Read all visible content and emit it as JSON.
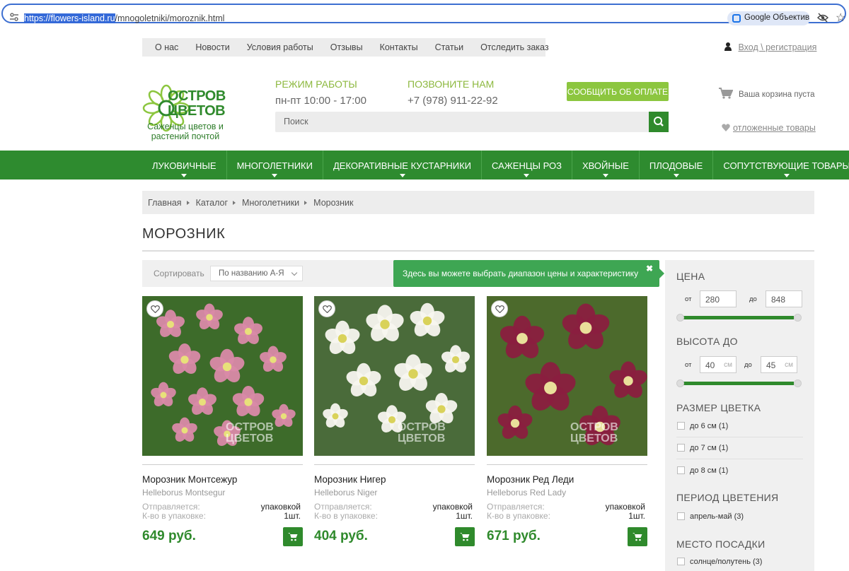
{
  "browser": {
    "url_selected": "https://flowers-island.ru",
    "url_rest": "/mnogoletniki/moroznik.html",
    "lens_label": "Google Объектив"
  },
  "topnav": {
    "items": [
      "О нас",
      "Новости",
      "Условия работы",
      "Отзывы",
      "Контакты",
      "Статьи",
      "Отследить заказ"
    ]
  },
  "login": {
    "label": "Вход \\ регистрация"
  },
  "logo": {
    "name_line1": "ОСТРОВ",
    "name_line2": "ЦВЕТОВ",
    "subtitle_line1": "Саженцы цветов и",
    "subtitle_line2": "растений почтой"
  },
  "hours": {
    "heading": "РЕЖИМ РАБОТЫ",
    "value": "пн-пт 10:00 - 17:00"
  },
  "phone": {
    "heading": "ПОЗВОНИТЕ НАМ",
    "value": "+7 (978) 911-22-92"
  },
  "payment_button": "СООБЩИТЬ ОБ ОПЛАТЕ",
  "cart": {
    "status": "Ваша корзина пуста"
  },
  "search": {
    "placeholder": "Поиск"
  },
  "wishlist": {
    "label": "отложенные товары"
  },
  "mainnav": {
    "items": [
      "ЛУКОВИЧНЫЕ",
      "МНОГОЛЕТНИКИ",
      "ДЕКОРАТИВНЫЕ КУСТАРНИКИ",
      "САЖЕНЦЫ РОЗ",
      "ХВОЙНЫЕ",
      "ПЛОДОВЫЕ",
      "СОПУТСТВУЮЩИЕ ТОВАРЫ"
    ]
  },
  "breadcrumb": [
    "Главная",
    "Каталог",
    "Многолетники",
    "Морозник"
  ],
  "page_title": "МОРОЗНИК",
  "sort": {
    "label": "Сортировать",
    "selected": "По названию А-Я"
  },
  "tooltip": {
    "text": "Здесь вы можете выбрать диапазон цены и характеристику",
    "close": "✖"
  },
  "products": [
    {
      "name": "Морозник Монтсежур",
      "latin": "Helleborus Montsegur",
      "ship_label": "Отправляется:",
      "ship_value": "упаковкой",
      "qty_label": "К-во в упаковке:",
      "qty_value": "1шт.",
      "price": "649 руб.",
      "watermark_line1": "ОСТРОВ",
      "watermark_line2": "ЦВЕТОВ",
      "palette": {
        "bg": "#3d6b2a",
        "petal": "#d98aa8",
        "center": "#e8e07a"
      }
    },
    {
      "name": "Морозник Нигер",
      "latin": "Helleborus Niger",
      "ship_label": "Отправляется:",
      "ship_value": "упаковкой",
      "qty_label": "К-во в упаковке:",
      "qty_value": "1шт.",
      "price": "404 руб.",
      "watermark_line1": "ОСТРОВ",
      "watermark_line2": "ЦВЕТОВ",
      "palette": {
        "bg": "#4a6b3a",
        "petal": "#f7f5ef",
        "center": "#d9d25a"
      }
    },
    {
      "name": "Морозник Ред Леди",
      "latin": "Helleborus Red Lady",
      "ship_label": "Отправляется:",
      "ship_value": "упаковкой",
      "qty_label": "К-во в упаковке:",
      "qty_value": "1шт.",
      "price": "671 руб.",
      "watermark_line1": "ОСТРОВ",
      "watermark_line2": "ЦВЕТОВ",
      "palette": {
        "bg": "#4c6a2c",
        "petal": "#8a1f3f",
        "center": "#e9df9a"
      }
    }
  ],
  "filters": {
    "price": {
      "heading": "ЦЕНА",
      "from_label": "от",
      "from_value": "280",
      "to_label": "до",
      "to_value": "848"
    },
    "height": {
      "heading": "ВЫСОТА ДО",
      "from_label": "от",
      "from_value": "40",
      "to_label": "до",
      "to_value": "45",
      "unit": "см"
    },
    "flower_size": {
      "heading": "РАЗМЕР ЦВЕТКА",
      "options": [
        "до 6 см (1)",
        "до 7 см (1)",
        "до 8 см (1)"
      ]
    },
    "bloom_period": {
      "heading": "ПЕРИОД ЦВЕТЕНИЯ",
      "options": [
        "апрель-май (3)"
      ]
    },
    "planting_place": {
      "heading": "МЕСТО ПОСАДКИ",
      "options": [
        "солнце/полутень (3)"
      ]
    }
  },
  "colors": {
    "brand_green": "#2e8b2f",
    "accent_lime": "#8cc63f",
    "tooltip_green": "#3ea653"
  }
}
